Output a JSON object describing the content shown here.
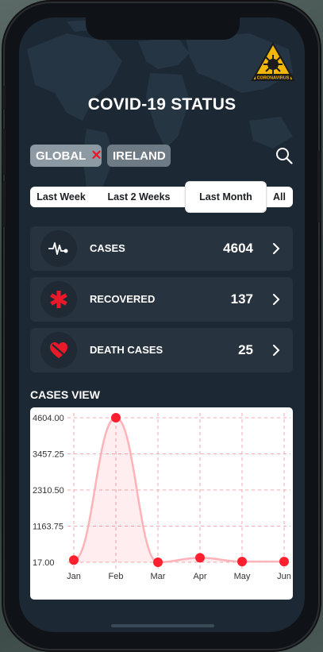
{
  "app": {
    "title": "COVID-19 STATUS",
    "logo_text": "CORONAVIRUS"
  },
  "filters": {
    "global_label": "GLOBAL",
    "remove_symbol": "✕",
    "ireland_label": "IRELAND"
  },
  "ranges": {
    "items": [
      "Last Week",
      "Last 2 Weeks",
      "Last Month",
      "All"
    ],
    "selected": "Last Month"
  },
  "stats": [
    {
      "label": "CASES",
      "value": "4604",
      "icon": "heartbeat-icon"
    },
    {
      "label": "RECOVERED",
      "value": "137",
      "icon": "medical-star-icon"
    },
    {
      "label": "DEATH CASES",
      "value": "25",
      "icon": "broken-heart-icon"
    }
  ],
  "colors": {
    "background": "#1c2833",
    "card": "#27333f",
    "accent_red": "#e81a2a",
    "chip_global": "#8e9aa3",
    "chip_ireland": "#6e7a84"
  },
  "chart_section_title": "CASES VIEW",
  "chart_data": {
    "type": "area",
    "categories": [
      "Jan",
      "Feb",
      "Mar",
      "Apr",
      "May",
      "Jun"
    ],
    "series": [
      {
        "values": [
          85,
          4604,
          17,
          160,
          40,
          40
        ]
      }
    ],
    "y_ticks": [
      "4604.00",
      "3457.25",
      "2310.50",
      "1163.75",
      "17.00"
    ],
    "ylim": [
      17,
      4604
    ],
    "grid": true,
    "color": "#ff1f2f"
  }
}
